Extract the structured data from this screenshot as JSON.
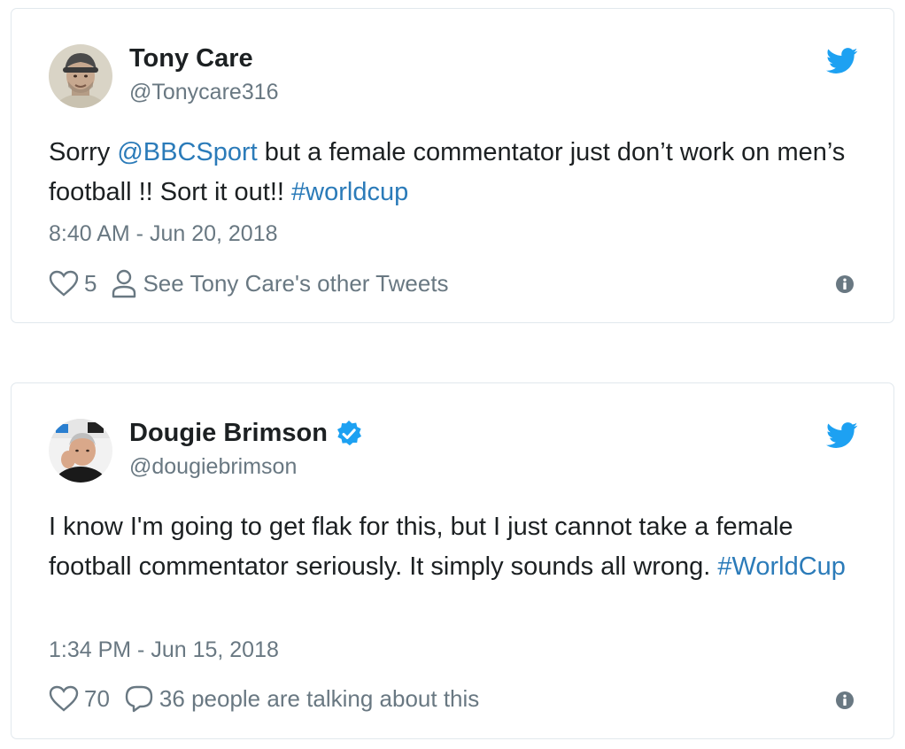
{
  "tweets": [
    {
      "author_name": "Tony Care",
      "verified": false,
      "handle": "@Tonycare316",
      "text_parts": {
        "p1": "Sorry ",
        "l1": "@BBCSport",
        "p2": " but a female commentator just don’t work on men’s football !!  Sort it out!! ",
        "l2": "#worldcup"
      },
      "timestamp": "8:40 AM - Jun 20, 2018",
      "likes": "5",
      "secondary_action": "See Tony Care's other Tweets",
      "icons": {
        "bird": "twitter-bird-icon",
        "like": "heart-icon",
        "secondary": "person-icon",
        "info": "info-icon"
      }
    },
    {
      "author_name": "Dougie Brimson",
      "verified": true,
      "handle": "@dougiebrimson",
      "text_parts": {
        "p1": "I know I'm going to get flak for this, but I just cannot take a female football commentator seriously. It simply sounds all wrong. ",
        "l1": "#WorldCup"
      },
      "timestamp": "1:34 PM - Jun 15, 2018",
      "likes": "70",
      "secondary_action": "36 people are talking about this",
      "icons": {
        "bird": "twitter-bird-icon",
        "like": "heart-icon",
        "secondary": "speech-bubble-icon",
        "verified": "verified-badge-icon",
        "info": "info-icon"
      }
    }
  ],
  "colors": {
    "link": "#2b7bb9",
    "twitter_blue": "#1da1f2",
    "muted": "#697882",
    "text": "#1c2022",
    "border": "#e1e8ed"
  }
}
